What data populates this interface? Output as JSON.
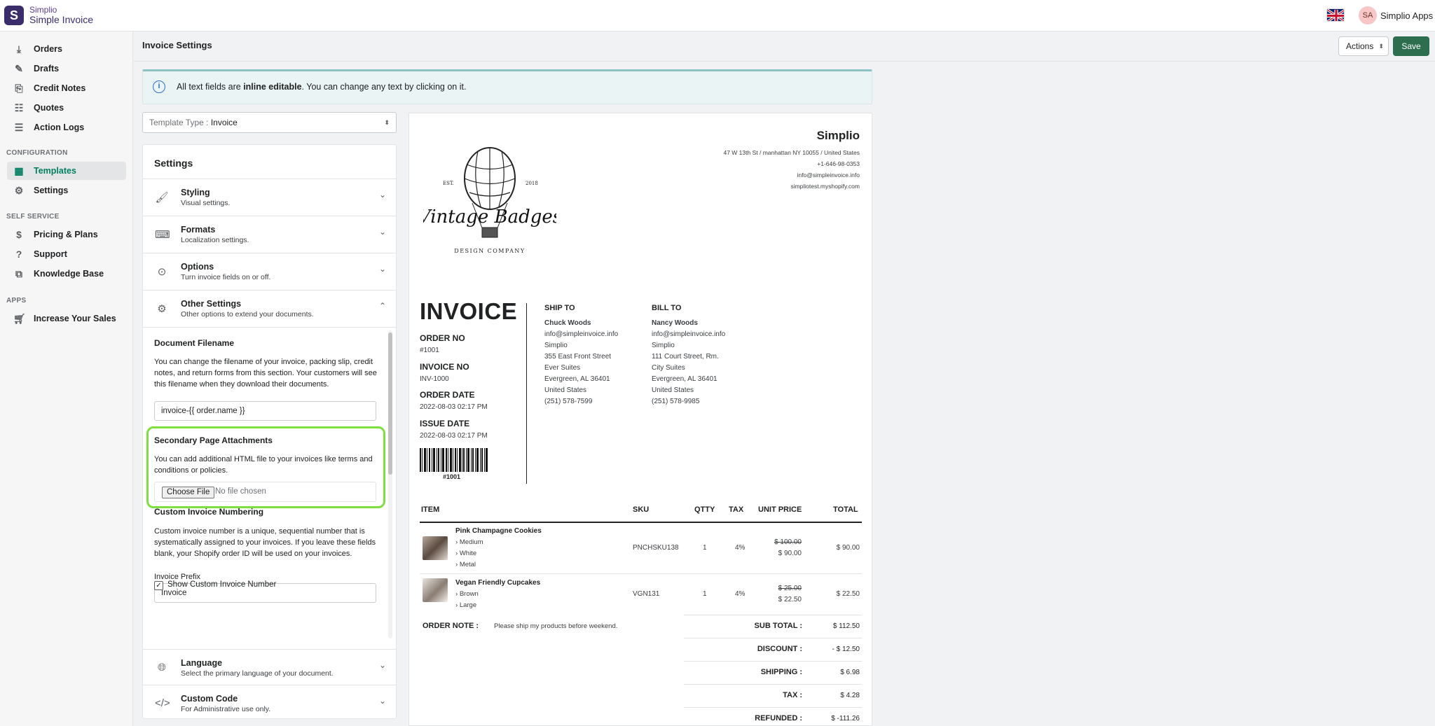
{
  "app": {
    "vendor": "Simplio",
    "name": "Simple Invoice",
    "logo_letter": "S"
  },
  "topbar": {
    "avatar_initials": "SA",
    "store_name": "Simplio Apps"
  },
  "sidebar": {
    "items": [
      {
        "label": "Orders",
        "icon": "download-icon"
      },
      {
        "label": "Drafts",
        "icon": "edit-icon"
      },
      {
        "label": "Credit Notes",
        "icon": "credit-note-icon"
      },
      {
        "label": "Quotes",
        "icon": "quotes-icon"
      },
      {
        "label": "Action Logs",
        "icon": "log-icon"
      }
    ],
    "config_title": "CONFIGURATION",
    "config_items": [
      {
        "label": "Templates",
        "icon": "template-icon",
        "active": true
      },
      {
        "label": "Settings",
        "icon": "gear-icon"
      }
    ],
    "self_service_title": "SELF SERVICE",
    "self_service_items": [
      {
        "label": "Pricing & Plans",
        "icon": "dollar-icon"
      },
      {
        "label": "Support",
        "icon": "question-icon"
      },
      {
        "label": "Knowledge Base",
        "icon": "book-icon"
      }
    ],
    "apps_title": "APPS",
    "apps_items": [
      {
        "label": "Increase Your Sales",
        "icon": "cart-icon"
      }
    ]
  },
  "header": {
    "title": "Invoice Settings",
    "actions_label": "Actions",
    "save_label": "Save"
  },
  "banner": {
    "text_before": "All text fields are ",
    "text_bold": "inline editable",
    "text_after": ". You can change any text by clicking on it."
  },
  "template_select": {
    "label": "Template Type : ",
    "value": "Invoice"
  },
  "settings": {
    "title": "Settings",
    "sections": [
      {
        "title": "Styling",
        "subtitle": "Visual settings."
      },
      {
        "title": "Formats",
        "subtitle": "Localization settings."
      },
      {
        "title": "Options",
        "subtitle": "Turn invoice fields on or off."
      },
      {
        "title": "Other Settings",
        "subtitle": "Other options to extend your documents."
      }
    ],
    "filename": {
      "title": "Document Filename",
      "text": "You can change the filename of your invoice, packing slip, credit notes, and return forms from this section. Your customers will see this filename when they download their documents.",
      "value": "invoice-{{ order.name }}"
    },
    "attachments": {
      "title": "Secondary Page Attachments",
      "text": "You can add additional HTML file to your invoices like terms and conditions or policies.",
      "button": "Choose File",
      "status": "No file chosen"
    },
    "numbering": {
      "title": "Custom Invoice Numbering",
      "text": "Custom invoice number is a unique, sequential number that is systematically assigned to your invoices. If you leave these fields blank, your Shopify order ID will be used on your invoices.",
      "checkbox_label": "Show Custom Invoice Number",
      "checked": true,
      "prefix_label": "Invoice Prefix",
      "prefix_value": "Invoice"
    },
    "bottom_sections": [
      {
        "title": "Language",
        "subtitle": "Select the primary language of your document."
      },
      {
        "title": "Custom Code",
        "subtitle": "For Administrative use only."
      }
    ]
  },
  "invoice": {
    "shop": {
      "name": "Simplio",
      "address": "47 W 13th St / manhattan NY 10055 / United States",
      "phone": "+1-646-98-0353",
      "email": "info@simpleinvoice.info",
      "domain": "simpliotest.myshopify.com"
    },
    "logo": {
      "est": "EST.",
      "year": "2018",
      "brand": "Vintage Badges",
      "tagline": "DESIGN COMPANY"
    },
    "title": "INVOICE",
    "order_no_label": "ORDER NO",
    "order_no": "#1001",
    "invoice_no_label": "INVOICE NO",
    "invoice_no": "INV-1000",
    "order_date_label": "ORDER DATE",
    "order_date": "2022-08-03 02:17 PM",
    "issue_date_label": "ISSUE DATE",
    "issue_date": "2022-08-03 02:17 PM",
    "barcode_text": "#1001",
    "ship_to": {
      "label": "SHIP TO",
      "name": "Chuck Woods",
      "lines": [
        "info@simpleinvoice.info",
        "Simplio",
        "355 East Front Street",
        "Ever Suites",
        "Evergreen, AL 36401",
        "United States",
        "(251) 578-7599"
      ]
    },
    "bill_to": {
      "label": "BILL TO",
      "name": "Nancy Woods",
      "lines": [
        "info@simpleinvoice.info",
        "Simplio",
        "111 Court Street, Rm.",
        "City Suites",
        "Evergreen, AL 36401",
        "United States",
        "(251) 578-9985"
      ]
    },
    "columns": {
      "item": "ITEM",
      "sku": "SKU",
      "qty": "QTTY",
      "tax": "TAX",
      "unit_price": "UNIT PRICE",
      "total": "TOTAL"
    },
    "items": [
      {
        "name": "Pink Champagne Cookies",
        "variants": [
          "Medium",
          "White",
          "Metal"
        ],
        "sku": "PNCHSKU138",
        "qty": "1",
        "tax": "4%",
        "old_price": "$ 100.00",
        "price": "$ 90.00",
        "total": "$ 90.00"
      },
      {
        "name": "Vegan Friendly Cupcakes",
        "variants": [
          "Brown",
          "Large"
        ],
        "sku": "VGN131",
        "qty": "1",
        "tax": "4%",
        "old_price": "$ 25.00",
        "price": "$ 22.50",
        "total": "$ 22.50"
      }
    ],
    "note_label": "ORDER NOTE :",
    "note": "Please ship my products before weekend.",
    "totals": [
      {
        "label": "SUB TOTAL :",
        "value": "$ 112.50"
      },
      {
        "label": "DISCOUNT :",
        "value": "- $ 12.50"
      },
      {
        "label": "SHIPPING :",
        "value": "$ 6.98"
      },
      {
        "label": "TAX :",
        "value": "$ 4.28"
      },
      {
        "label": "REFUNDED :",
        "value": "$ -111.26"
      }
    ]
  }
}
